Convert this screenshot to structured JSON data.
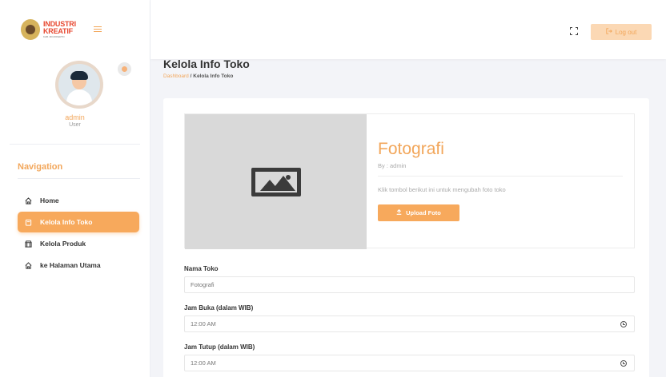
{
  "app": {
    "logo_line1": "INDUSTRI",
    "logo_line2": "KREATIF",
    "logo_line3": "KAB. MOJOKERTO",
    "accent_color": "#f7a95c"
  },
  "profile": {
    "name": "admin",
    "role": "User"
  },
  "sidebar": {
    "section_title": "Navigation",
    "items": [
      {
        "label": "Home",
        "icon": "home-icon",
        "active": false
      },
      {
        "label": "Kelola Info Toko",
        "icon": "store-icon",
        "active": true
      },
      {
        "label": "Kelola Produk",
        "icon": "box-icon",
        "active": false
      },
      {
        "label": "ke Halaman Utama",
        "icon": "home-icon",
        "active": false
      }
    ]
  },
  "topbar": {
    "logout_label": "Log out"
  },
  "page": {
    "title": "Kelola Info Toko",
    "breadcrumb_root": "Dashboard",
    "breadcrumb_sep": "/",
    "breadcrumb_current": "Kelola Info Toko"
  },
  "shop": {
    "name": "Fotografi",
    "by": "By : admin",
    "hint": "Klik tombol berikut ini untuk mengubah foto toko",
    "upload_label": "Upload Foto"
  },
  "form": {
    "nama_toko_label": "Nama Toko",
    "nama_toko_value": "Fotografi",
    "jam_buka_label": "Jam Buka (dalam WIB)",
    "jam_buka_value": "12:00 AM",
    "jam_tutup_label": "Jam Tutup (dalam WIB)",
    "jam_tutup_value": "12:00 AM"
  }
}
